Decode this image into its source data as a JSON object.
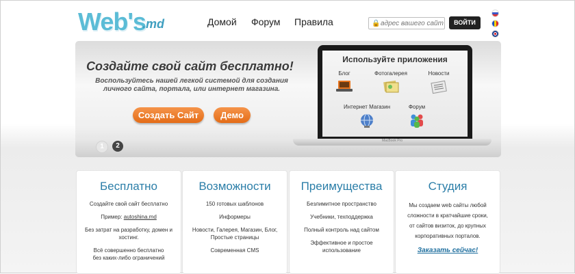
{
  "header": {
    "logo_text": "Web's",
    "logo_suffix": ".md",
    "nav": [
      "Домой",
      "Форум",
      "Правила"
    ],
    "search_placeholder": "адрес вашего сайта",
    "login_label": "ВОЙТИ",
    "languages": [
      "ru",
      "md",
      "gb"
    ]
  },
  "banner": {
    "headline": "Создайте свой сайт бесплатно!",
    "subline": "Воспользуйтесь нашей легкой системой для создания личного сайта, портала, или интернет магазина.",
    "create_button": "Создать Сайт",
    "demo_button": "Демо",
    "slides": [
      "1",
      "2"
    ],
    "active_slide": "2",
    "screen_title": "Используйте приложения",
    "apps": [
      "Блог",
      "Фотогалерея",
      "Новости",
      "Интернет Магазин",
      "Форум"
    ],
    "laptop_label": "MacBook Pro"
  },
  "features": [
    {
      "title": "Бесплатно",
      "lines": [
        "Создайте свой сайт бесплатно",
        "Пример:",
        "autoshina.md",
        "Без затрат на разработку, домен и хостинг.",
        "Всё совершенно бесплатно",
        "без каких-либо ограничений"
      ]
    },
    {
      "title": "Возможности",
      "lines": [
        "150 готовых шаблонов",
        "Информеры",
        "Новости, Галерея, Магазин, Блог, Простые страницы",
        "Современная CMS"
      ]
    },
    {
      "title": "Преимущества",
      "lines": [
        "Безлимитное пространство",
        "Учебники, техподдержка",
        "Полный контроль над сайтом",
        "Эффективное и простое использование"
      ]
    },
    {
      "title": "Студия",
      "lines": [
        "Мы создаем web сайты любой сложности в кратчайшие сроки, от сайтов визиток, до крупных корпоративных порталов."
      ],
      "order_link": "Заказать сейчас!"
    }
  ],
  "colors": {
    "accent_orange": "#e8752a",
    "title_blue": "#2b7ea8",
    "logo_blue": "#5bbcd6"
  }
}
